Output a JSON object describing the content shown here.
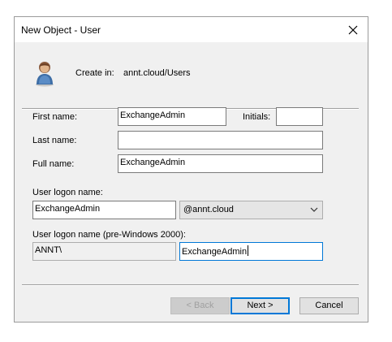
{
  "dialog": {
    "title": "New Object - User",
    "close_icon": "close-icon"
  },
  "header": {
    "user_icon": "user-icon",
    "create_in_label": "Create in:",
    "create_in_path": "annt.cloud/Users"
  },
  "form": {
    "first_name_label": "First name:",
    "first_name_value": "ExchangeAdmin",
    "initials_label": "Initials:",
    "initials_value": "",
    "last_name_label": "Last name:",
    "last_name_value": "",
    "full_name_label": "Full name:",
    "full_name_value": "ExchangeAdmin",
    "logon_name_label": "User logon name:",
    "logon_name_value": "ExchangeAdmin",
    "domain_selected": "@annt.cloud",
    "pre2000_label": "User logon name (pre-Windows 2000):",
    "pre2000_domain": "ANNT\\",
    "pre2000_value": "ExchangeAdmin"
  },
  "buttons": {
    "back": "< Back",
    "next": "Next >",
    "cancel": "Cancel"
  }
}
